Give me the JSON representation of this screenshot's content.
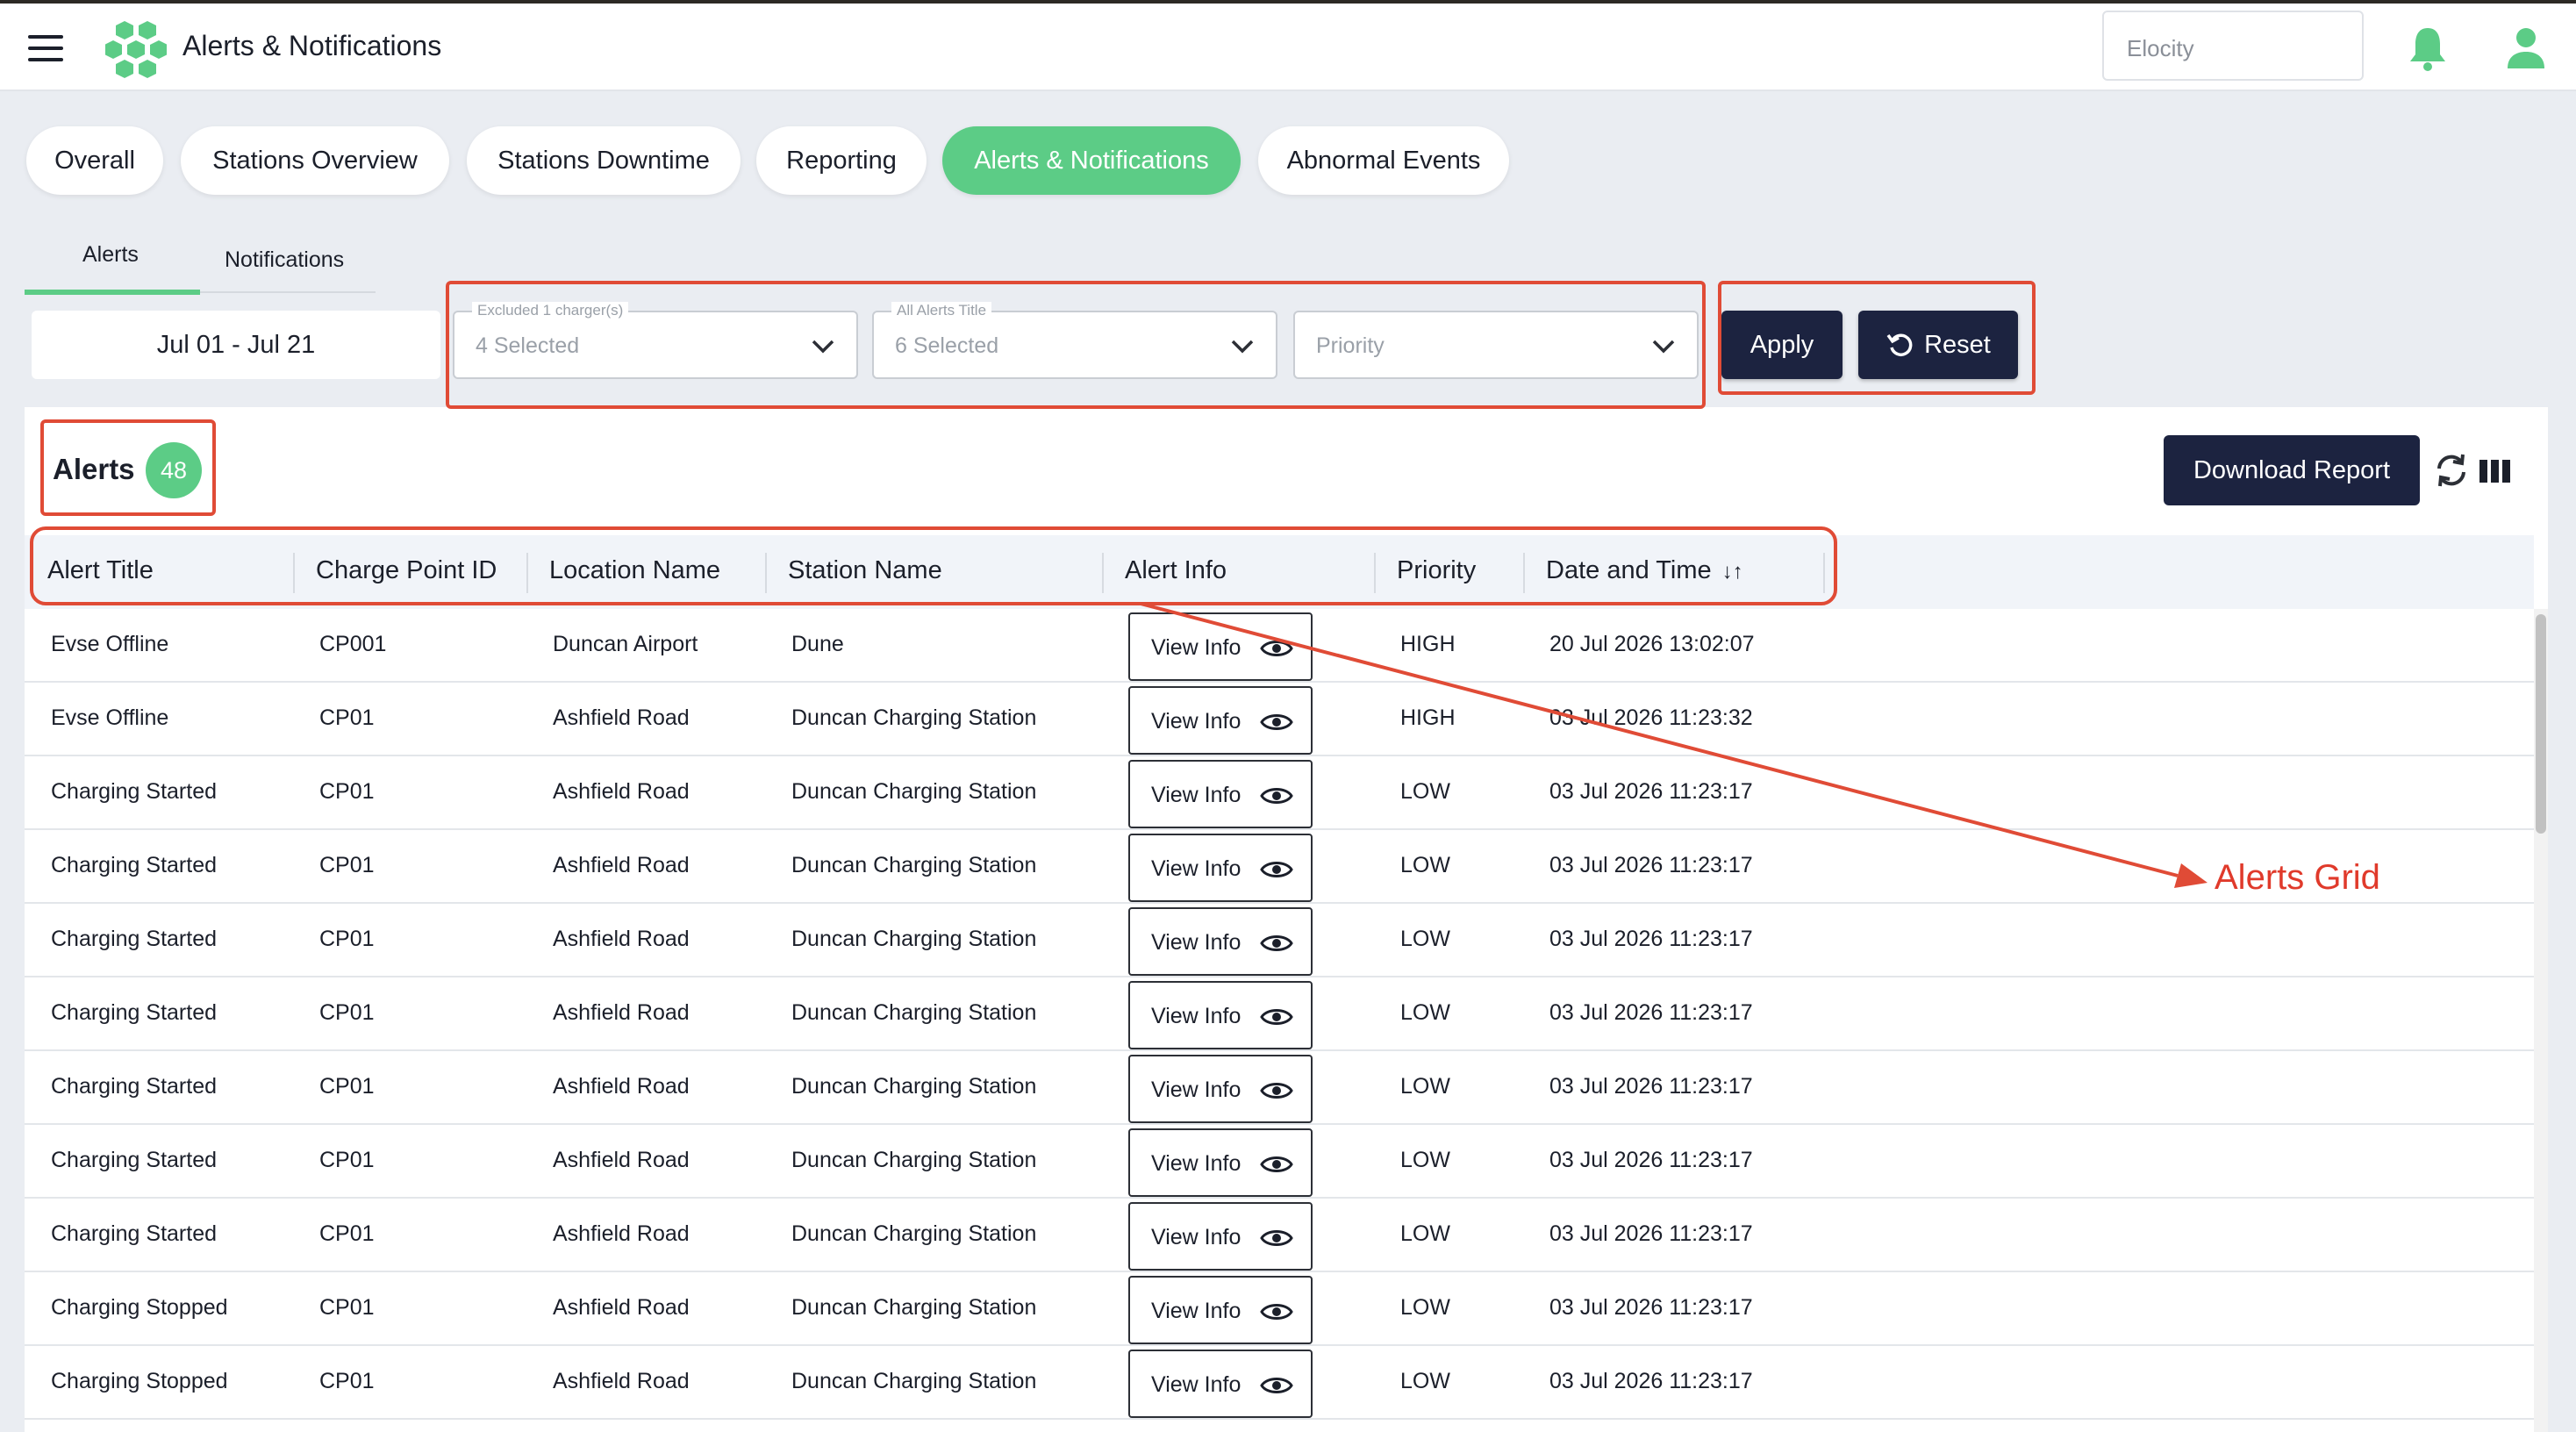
{
  "appbar": {
    "title": "Alerts & Notifications",
    "org_placeholder": "Elocity"
  },
  "colors": {
    "accent": "#5ccc86",
    "dark_button": "#1c2340",
    "annotation": "#e04b36"
  },
  "tabs": [
    {
      "label": "Overall",
      "active": false
    },
    {
      "label": "Stations Overview",
      "active": false
    },
    {
      "label": "Stations Downtime",
      "active": false
    },
    {
      "label": "Reporting",
      "active": false
    },
    {
      "label": "Alerts & Notifications",
      "active": true
    },
    {
      "label": "Abnormal Events",
      "active": false
    }
  ],
  "subtabs": [
    {
      "label": "Alerts",
      "active": true
    },
    {
      "label": "Notifications",
      "active": false
    }
  ],
  "filters": {
    "date_range": "Jul 01 - Jul 21",
    "charger": {
      "label": "Excluded 1 charger(s)",
      "value": "4 Selected"
    },
    "alert_title": {
      "label": "All Alerts Title",
      "value": "6 Selected"
    },
    "priority": {
      "placeholder": "Priority"
    },
    "apply_label": "Apply",
    "reset_label": "Reset"
  },
  "alerts": {
    "title": "Alerts",
    "count": "48",
    "download_label": "Download Report"
  },
  "grid": {
    "columns": [
      "Alert Title",
      "Charge Point ID",
      "Location Name",
      "Station Name",
      "Alert Info",
      "Priority",
      "Date and Time"
    ],
    "sort_indicator": "↓↑",
    "view_label": "View Info",
    "rows": [
      {
        "title": "Evse Offline",
        "cp": "CP001",
        "location": "Duncan Airport",
        "station": "Dune",
        "priority": "HIGH",
        "datetime": "20 Jul 2026 13:02:07"
      },
      {
        "title": "Evse Offline",
        "cp": "CP01",
        "location": "Ashfield Road",
        "station": "Duncan Charging Station",
        "priority": "HIGH",
        "datetime": "03 Jul 2026 11:23:32"
      },
      {
        "title": "Charging Started",
        "cp": "CP01",
        "location": "Ashfield Road",
        "station": "Duncan Charging Station",
        "priority": "LOW",
        "datetime": "03 Jul 2026 11:23:17"
      },
      {
        "title": "Charging Started",
        "cp": "CP01",
        "location": "Ashfield Road",
        "station": "Duncan Charging Station",
        "priority": "LOW",
        "datetime": "03 Jul 2026 11:23:17"
      },
      {
        "title": "Charging Started",
        "cp": "CP01",
        "location": "Ashfield Road",
        "station": "Duncan Charging Station",
        "priority": "LOW",
        "datetime": "03 Jul 2026 11:23:17"
      },
      {
        "title": "Charging Started",
        "cp": "CP01",
        "location": "Ashfield Road",
        "station": "Duncan Charging Station",
        "priority": "LOW",
        "datetime": "03 Jul 2026 11:23:17"
      },
      {
        "title": "Charging Started",
        "cp": "CP01",
        "location": "Ashfield Road",
        "station": "Duncan Charging Station",
        "priority": "LOW",
        "datetime": "03 Jul 2026 11:23:17"
      },
      {
        "title": "Charging Started",
        "cp": "CP01",
        "location": "Ashfield Road",
        "station": "Duncan Charging Station",
        "priority": "LOW",
        "datetime": "03 Jul 2026 11:23:17"
      },
      {
        "title": "Charging Started",
        "cp": "CP01",
        "location": "Ashfield Road",
        "station": "Duncan Charging Station",
        "priority": "LOW",
        "datetime": "03 Jul 2026 11:23:17"
      },
      {
        "title": "Charging Stopped",
        "cp": "CP01",
        "location": "Ashfield Road",
        "station": "Duncan Charging Station",
        "priority": "LOW",
        "datetime": "03 Jul 2026 11:23:17"
      },
      {
        "title": "Charging Stopped",
        "cp": "CP01",
        "location": "Ashfield Road",
        "station": "Duncan Charging Station",
        "priority": "LOW",
        "datetime": "03 Jul 2026 11:23:17"
      }
    ]
  },
  "annotation": {
    "label": "Alerts Grid"
  }
}
